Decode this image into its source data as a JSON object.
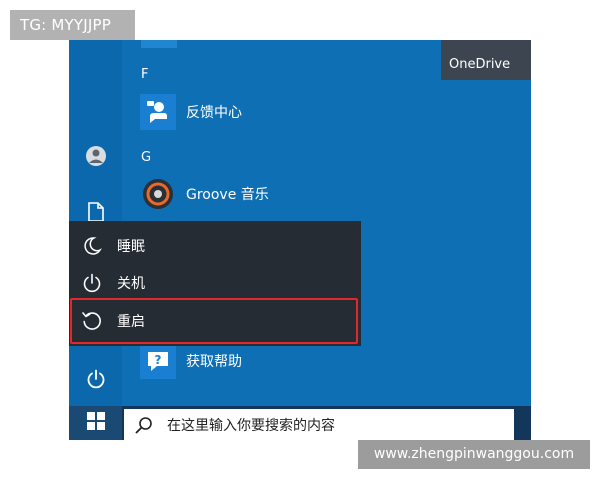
{
  "overlay": {
    "tag": "TG: MYYJJPP",
    "watermark": "www.zhengpinwanggou.com"
  },
  "start_menu": {
    "tile": {
      "label": "OneDrive"
    },
    "sections": [
      {
        "letter": "F",
        "apps": [
          {
            "label": "反馈中心",
            "icon": "feedback-hub-icon"
          }
        ]
      },
      {
        "letter": "G",
        "apps": [
          {
            "label": "Groove 音乐",
            "icon": "groove-music-icon"
          }
        ]
      }
    ],
    "hidden_app": {
      "label": "获取帮助",
      "icon": "get-help-icon"
    },
    "rail_icons": [
      "user-avatar-icon",
      "document-icon",
      "power-icon"
    ]
  },
  "power_menu": {
    "items": [
      {
        "label": "睡眠",
        "icon": "sleep-moon-icon"
      },
      {
        "label": "关机",
        "icon": "power-icon"
      },
      {
        "label": "重启",
        "icon": "restart-icon",
        "highlighted": true
      }
    ],
    "highlight_color": "#e1282a"
  },
  "taskbar": {
    "start_icon": "windows-logo-icon",
    "search": {
      "icon": "search-icon",
      "placeholder": "在这里输入你要搜索的内容"
    }
  },
  "colors": {
    "desktop_blue": "#0f6fb5",
    "power_menu_bg": "#262c33",
    "taskbar_bg": "#12375a"
  }
}
